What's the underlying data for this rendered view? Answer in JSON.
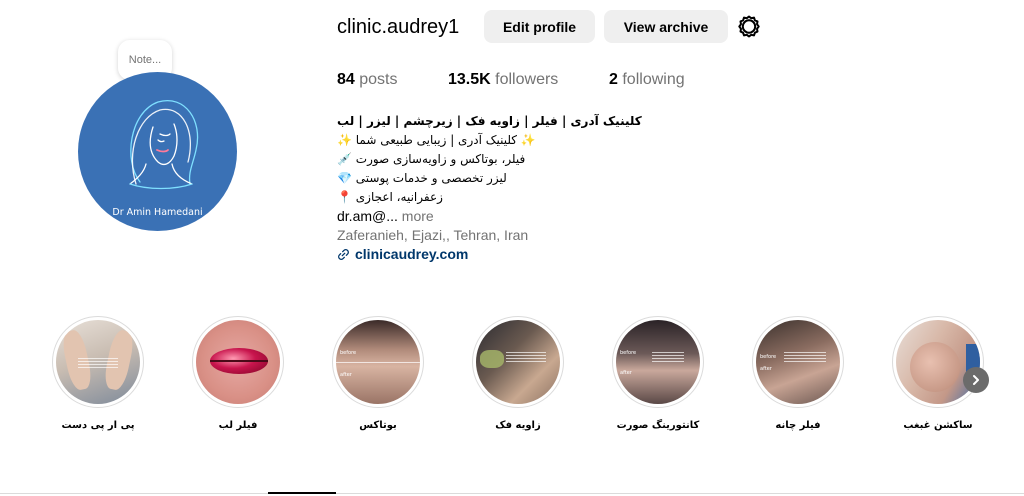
{
  "note": {
    "placeholder": "Note..."
  },
  "avatar": {
    "caption": "Dr Amin Hamedani"
  },
  "profile": {
    "username": "clinic.audrey1",
    "edit_label": "Edit profile",
    "archive_label": "View archive",
    "settings_icon": "settings-gear-icon"
  },
  "stats": {
    "posts_count": "84",
    "posts_label": "posts",
    "followers_count": "13.5K",
    "followers_label": "followers",
    "following_count": "2",
    "following_label": "following"
  },
  "bio": {
    "name": "کلینیک آدری | فیلر | زاویه فک | زیرچشم | لیزر | لب",
    "line1": "✨ کلینیک آدری | زیبایی طبیعی شما ✨",
    "line2": "💉 فیلر، بوتاکس و زاویه‌سازی صورت",
    "line3": "💎 لیزر تخصصی و خدمات پوستی",
    "line4": "📍 زعفرانیه، اعجازی",
    "line5": "dr.am@...",
    "more_label": "more",
    "location": "Zaferanieh, Ejazi,, Tehran, Iran",
    "link": "clinicaudrey.com"
  },
  "highlights": [
    {
      "label": "پی ار پی دست"
    },
    {
      "label": "فیلر لب"
    },
    {
      "label": "بوتاکس"
    },
    {
      "label": "زاویه فک"
    },
    {
      "label": "کانتورینگ صورت"
    },
    {
      "label": "فیلر چانه"
    },
    {
      "label": "ساکشن غبغب"
    }
  ],
  "highlight_tags": {
    "before": "before",
    "after": "after"
  },
  "colors": {
    "avatar_bg": "#3a71b5",
    "button_bg": "#efefef",
    "link": "#00376b",
    "muted": "#737373"
  }
}
